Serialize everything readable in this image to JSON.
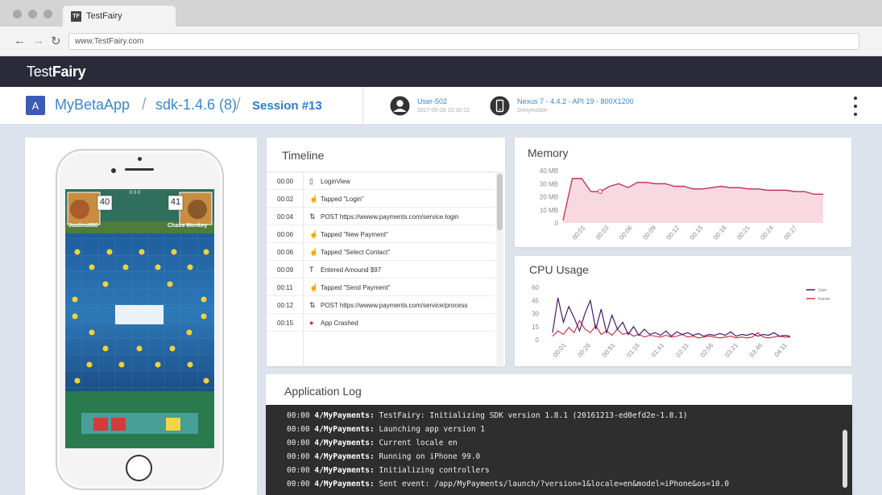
{
  "browser": {
    "tab_title": "TestFairy",
    "tab_icon": "TF",
    "address": "www.TestFairy.com",
    "back_icon": "back-arrow-icon",
    "forward_icon": "forward-arrow-icon",
    "reload_icon": "reload-icon"
  },
  "app_header": {
    "logo_light": "Test",
    "logo_bold": "Fairy"
  },
  "breadcrumb": {
    "app_badge": "A",
    "app_name": "MyBetaApp",
    "version": "sdk-1.4.6 (8)",
    "session": "Session #13",
    "separator": "/"
  },
  "session_meta": {
    "user": "User-502",
    "user_time": "2017-05-28 15:30:12",
    "device": "Nexus 7 - 4.4.2 - API 19 - 800X1200",
    "device_sub": "Genymotion"
  },
  "game": {
    "player_left_score": "40",
    "player_left_name": "Justino800",
    "player_right_score": "41",
    "player_right_name": "Chaos Monkey",
    "top_score": "0 0 0"
  },
  "timeline": {
    "title": "Timeline",
    "rows": [
      {
        "time": "00:00",
        "icon": "▯",
        "icon_name": "screen-icon",
        "event": "LoginView"
      },
      {
        "time": "00:02",
        "icon": "☝",
        "icon_name": "tap-icon",
        "event": "Tapped \"Login\""
      },
      {
        "time": "00:04",
        "icon": "⇅",
        "icon_name": "network-icon",
        "event": "POST https://wwww.payments.com/service.login"
      },
      {
        "time": "00:06",
        "icon": "☝",
        "icon_name": "tap-icon",
        "event": "Tapped \"New Payment\""
      },
      {
        "time": "00:06",
        "icon": "☝",
        "icon_name": "tap-icon",
        "event": "Tapped \"Select Contact\""
      },
      {
        "time": "00:09",
        "icon": "T",
        "icon_name": "text-input-icon",
        "event": "Entered Amound $97"
      },
      {
        "time": "00:11",
        "icon": "☝",
        "icon_name": "tap-icon",
        "event": "Tapped \"Send Payment\""
      },
      {
        "time": "00:12",
        "icon": "⇅",
        "icon_name": "network-icon",
        "event": "POST https://wwww.payments.com/service/process"
      },
      {
        "time": "00:15",
        "icon": "●",
        "icon_name": "crash-icon",
        "event": "App Crashed"
      }
    ]
  },
  "log": {
    "title": "Application Log",
    "lines": [
      {
        "time": "00:00",
        "tag": "4/MyPayments:",
        "msg": "TestFairy: Initializing SDK version 1.8.1 (20161213-ed0efd2e-1.8.1)"
      },
      {
        "time": "00:00",
        "tag": "4/MyPayments:",
        "msg": "Launching app version 1"
      },
      {
        "time": "00:00",
        "tag": "4/MyPayments:",
        "msg": "Current locale en"
      },
      {
        "time": "00:00",
        "tag": "4/MyPayments:",
        "msg": "Running on iPhone 99.0"
      },
      {
        "time": "00:00",
        "tag": "4/MyPayments:",
        "msg": "Initializing controllers"
      },
      {
        "time": "00:00",
        "tag": "4/MyPayments:",
        "msg": "Sent event: /app/MyPayments/launch/?version=1&locale=en&model=iPhone&os=10.0"
      }
    ]
  },
  "chart_data": [
    {
      "type": "area",
      "title": "Memory",
      "ylim": [
        0,
        40
      ],
      "yticks": [
        "40 MB",
        "30 MB",
        "20 MB",
        "10 MB",
        "0"
      ],
      "x": [
        "00:01",
        "00:03",
        "00:06",
        "00:09",
        "00:12",
        "00:15",
        "00:18",
        "00:21",
        "00:24",
        "00:27"
      ],
      "values": [
        2,
        34,
        34,
        24,
        24,
        28,
        30,
        27,
        31,
        31,
        30,
        30,
        28,
        28,
        26,
        26,
        27,
        28,
        27,
        27,
        26,
        26,
        25,
        25,
        25,
        24,
        24,
        22,
        22
      ],
      "marker_index": 4,
      "color": "#c0395a",
      "fill": "#f9d9e1"
    },
    {
      "type": "line",
      "title": "CPU Usage",
      "ylim": [
        0,
        60
      ],
      "yticks": [
        "60",
        "45",
        "30",
        "15",
        "0"
      ],
      "x": [
        "00:01",
        "00:26",
        "00:51",
        "01:16",
        "01:41",
        "02:31",
        "02:56",
        "03:21",
        "03:46",
        "04:11"
      ],
      "series": [
        {
          "name": "User",
          "color": "#4a1a6b",
          "values": [
            8,
            48,
            20,
            38,
            25,
            10,
            30,
            45,
            12,
            35,
            8,
            28,
            12,
            20,
            6,
            15,
            5,
            12,
            6,
            8,
            5,
            10,
            4,
            9,
            6,
            8,
            5,
            7,
            4,
            6,
            5,
            7,
            5,
            9,
            4,
            6,
            5,
            7,
            4,
            6,
            5,
            8,
            4,
            5,
            4
          ]
        },
        {
          "name": "Kernel",
          "color": "#d0344d",
          "values": [
            4,
            10,
            6,
            14,
            8,
            22,
            12,
            8,
            16,
            6,
            10,
            5,
            12,
            6,
            8,
            4,
            6,
            3,
            5,
            4,
            3,
            5,
            3,
            4,
            6,
            3,
            4,
            2,
            3,
            4,
            3,
            2,
            3,
            4,
            2,
            3,
            2,
            3,
            8,
            3,
            2,
            3,
            4,
            3,
            3
          ]
        }
      ]
    }
  ]
}
